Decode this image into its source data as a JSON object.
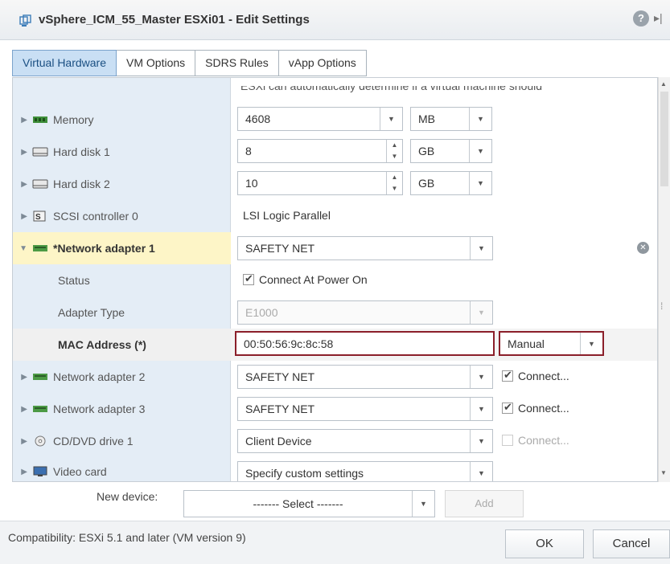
{
  "window": {
    "title": "vSphere_ICM_55_Master ESXi01 - Edit Settings",
    "help_glyph": "?",
    "more_glyph": "▸|"
  },
  "tabs": [
    "Virtual Hardware",
    "VM Options",
    "SDRS Rules",
    "vApp Options"
  ],
  "grid": {
    "cut_text": "ESXi can automatically determine if a virtual machine should",
    "memory": {
      "label": "Memory",
      "value": "4608",
      "unit": "MB"
    },
    "hard_disk_1": {
      "label": "Hard disk 1",
      "value": "8",
      "unit": "GB"
    },
    "hard_disk_2": {
      "label": "Hard disk 2",
      "value": "10",
      "unit": "GB"
    },
    "scsi": {
      "label": "SCSI controller 0",
      "value": "LSI Logic Parallel"
    },
    "net1": {
      "label": "*Network adapter 1",
      "network": "SAFETY NET"
    },
    "status": {
      "label": "Status",
      "checkbox_label": "Connect At Power On"
    },
    "adapter_type": {
      "label": "Adapter Type",
      "value": "E1000"
    },
    "mac": {
      "label": "MAC Address (*)",
      "value": "00:50:56:9c:8c:58",
      "mode": "Manual"
    },
    "net2": {
      "label": "Network adapter 2",
      "network": "SAFETY NET",
      "connect": "Connect..."
    },
    "net3": {
      "label": "Network adapter 3",
      "network": "SAFETY NET",
      "connect": "Connect..."
    },
    "cd": {
      "label": "CD/DVD drive 1",
      "value": "Client Device",
      "connect": "Connect..."
    },
    "video": {
      "label": "Video card",
      "value": "Specify custom settings"
    }
  },
  "new_device": {
    "label": "New device:",
    "select": "------- Select -------",
    "add": "Add"
  },
  "footer": {
    "compat": "Compatibility: ESXi 5.1 and later (VM version 9)",
    "ok": "OK",
    "cancel": "Cancel"
  }
}
